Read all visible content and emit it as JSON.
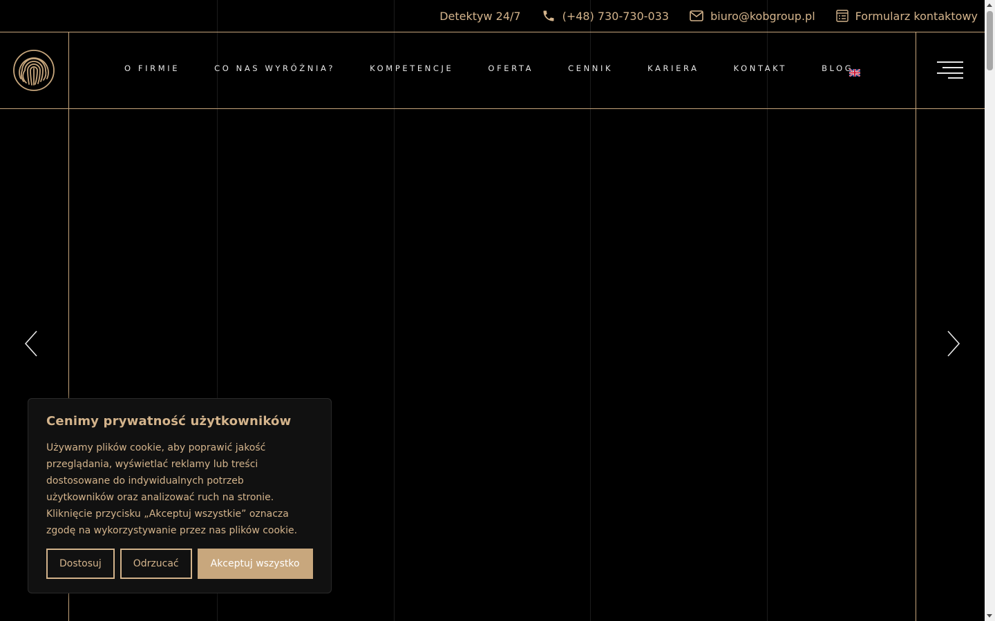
{
  "topbar": {
    "detective_label": "Detektyw 24/7",
    "phone": "(+48) 730-730-033",
    "email": "biuro@kobgroup.pl",
    "contact_form": "Formularz kontaktowy"
  },
  "nav": {
    "items": [
      {
        "label": "O FIRMIE"
      },
      {
        "label": "CO NAS WYRÓŻNIA?"
      },
      {
        "label": "KOMPETENCJE"
      },
      {
        "label": "OFERTA"
      },
      {
        "label": "CENNIK"
      },
      {
        "label": "KARIERA"
      },
      {
        "label": "KONTAKT"
      },
      {
        "label": "BLOG"
      }
    ],
    "language": "EN"
  },
  "icons": {
    "logo": "fingerprint-logo",
    "phone": "phone-icon",
    "email": "envelope-icon",
    "form": "form-icon",
    "menu": "hamburger-icon",
    "prev": "chevron-left-icon",
    "next": "chevron-right-icon",
    "flag": "uk-flag-icon"
  },
  "cookie": {
    "title": "Cenimy prywatność użytkowników",
    "body": "Używamy plików cookie, aby poprawić jakość przeglądania, wyświetlać reklamy lub treści dostosowane do indywidualnych potrzeb użytkowników oraz analizować ruch na stronie. Kliknięcie przycisku „Akceptuj wszystkie” oznacza zgodę na wykorzystywanie przez nas plików cookie.",
    "customize_label": "Dostosuj",
    "reject_label": "Odrzucać",
    "accept_label": "Akceptuj wszystko"
  },
  "colors": {
    "accent": "#c8a77d",
    "background": "#000000",
    "nav_text": "#e8e8e8"
  }
}
